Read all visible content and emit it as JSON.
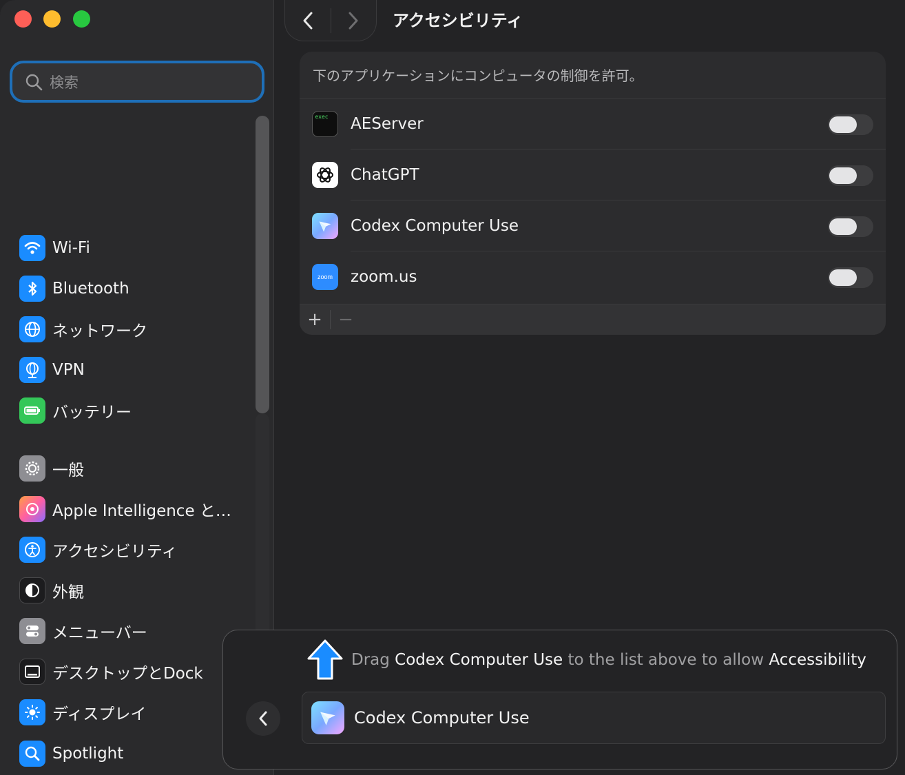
{
  "window": {
    "title": "アクセシビリティ"
  },
  "sidebar": {
    "search_placeholder": "検索",
    "items": [
      {
        "label": "Wi-Fi",
        "icon": "wifi-icon",
        "color": "#1a8cff"
      },
      {
        "label": "Bluetooth",
        "icon": "bluetooth-icon",
        "color": "#1a8cff"
      },
      {
        "label": "ネットワーク",
        "icon": "globe-icon",
        "color": "#1a8cff"
      },
      {
        "label": "VPN",
        "icon": "vpn-globe-icon",
        "color": "#1a8cff"
      },
      {
        "label": "バッテリー",
        "icon": "battery-icon",
        "color": "#34c759"
      },
      {
        "label": "一般",
        "icon": "gear-icon",
        "color": "#8e8e93"
      },
      {
        "label": "Apple Intelligence と…",
        "icon": "apple-intelligence-icon",
        "color": "#ff6ab0"
      },
      {
        "label": "アクセシビリティ",
        "icon": "accessibility-icon",
        "color": "#1a8cff"
      },
      {
        "label": "外観",
        "icon": "appearance-icon",
        "color": "#1c1c1e"
      },
      {
        "label": "メニューバー",
        "icon": "menubar-icon",
        "color": "#8e8e93"
      },
      {
        "label": "デスクトップとDock",
        "icon": "dock-icon",
        "color": "#1c1c1e"
      },
      {
        "label": "ディスプレイ",
        "icon": "display-brightness-icon",
        "color": "#1a8cff"
      },
      {
        "label": "Spotlight",
        "icon": "spotlight-search-icon",
        "color": "#1a8cff"
      }
    ]
  },
  "panel": {
    "header": "下のアプリケーションにコンピュータの制御を許可。",
    "apps": [
      {
        "name": "AEServer",
        "icon": "exec-terminal-icon",
        "icon_text": "exec",
        "enabled": false
      },
      {
        "name": "ChatGPT",
        "icon": "chatgpt-icon",
        "enabled": false
      },
      {
        "name": "Codex Computer Use",
        "icon": "codex-icon",
        "enabled": false
      },
      {
        "name": "zoom.us",
        "icon": "zoom-icon",
        "icon_text": "zoom",
        "enabled": false
      }
    ],
    "add_label": "+",
    "remove_label": "−"
  },
  "overlay": {
    "hint_prefix": "Drag ",
    "hint_app": "Codex Computer Use",
    "hint_middle": " to the list above to allow ",
    "hint_target": "Accessibility",
    "drag_item": "Codex Computer Use"
  },
  "colors": {
    "accent": "#1e6fb8",
    "hint_arrow": "#1a8cff"
  }
}
